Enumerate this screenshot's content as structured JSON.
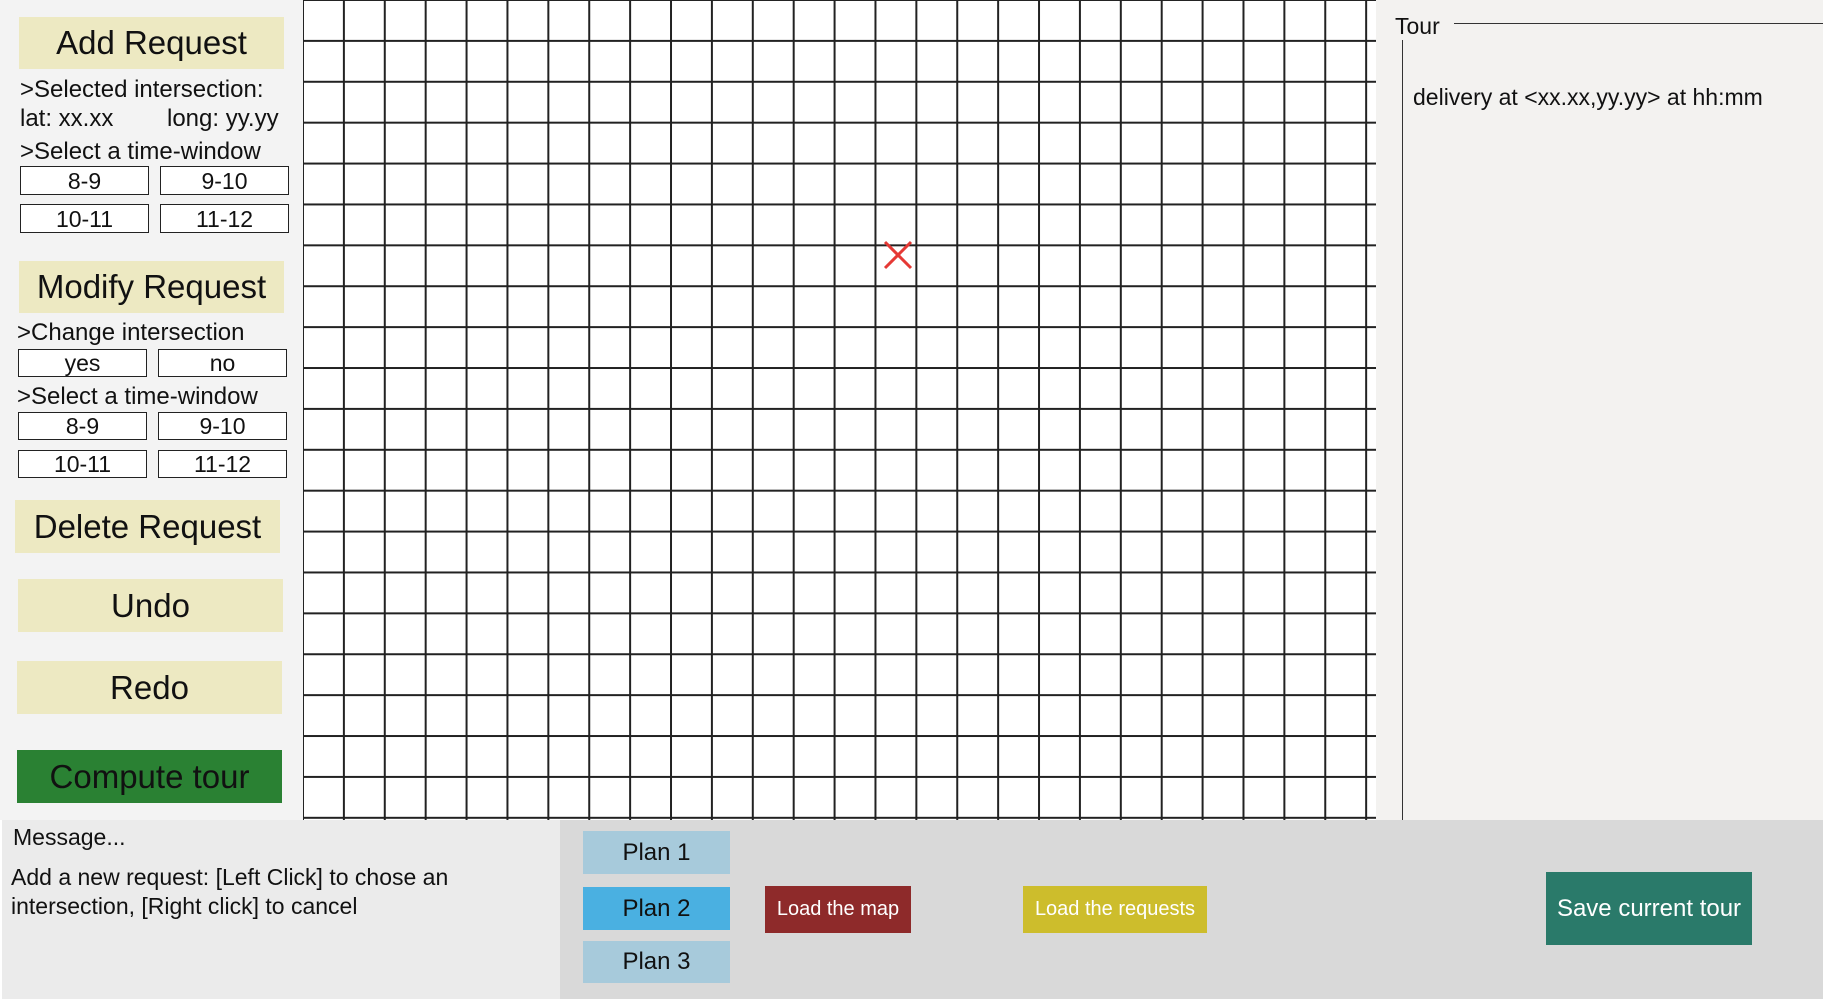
{
  "left_panel": {
    "add_request": "Add Request",
    "selected_intersection_label": ">Selected intersection:",
    "lat": "lat: xx.xx",
    "long": "long: yy.yy",
    "select_time_window_add": ">Select a time-window",
    "add_time_windows": [
      "8-9",
      "9-10",
      "10-11",
      "11-12"
    ],
    "modify_request": "Modify Request",
    "change_intersection": ">Change intersection",
    "yes": "yes",
    "no": "no",
    "select_time_window_modify": ">Select a time-window",
    "modify_time_windows": [
      "8-9",
      "9-10",
      "10-11",
      "11-12"
    ],
    "delete_request": "Delete Request",
    "undo": "Undo",
    "redo": "Redo",
    "compute_tour": "Compute tour"
  },
  "tour": {
    "title": "Tour",
    "entries": [
      "delivery at <xx.xx,yy.yy> at hh:mm"
    ]
  },
  "message": {
    "title": "Message...",
    "line1": "Add a new request: [Left Click] to chose an",
    "line2": "intersection, [Right click] to cancel"
  },
  "bottom": {
    "plans": [
      "Plan 1",
      "Plan 2",
      "Plan 3"
    ],
    "active_plan": "Plan 2",
    "load_map": "Load the map",
    "load_requests": "Load the requests",
    "save_tour": "Save current tour"
  },
  "colors": {
    "request_button": "#ede9c2",
    "compute_button": "#2a8133",
    "plan_button": "#a7cadb",
    "plan_active": "#4ab0e1",
    "load_map": "#8e2a2a",
    "load_requests": "#cdbd2c",
    "save_tour": "#2a7a6a",
    "selected_marker": "#e53935"
  },
  "icons": {
    "selected_marker": "x-marker-icon"
  }
}
